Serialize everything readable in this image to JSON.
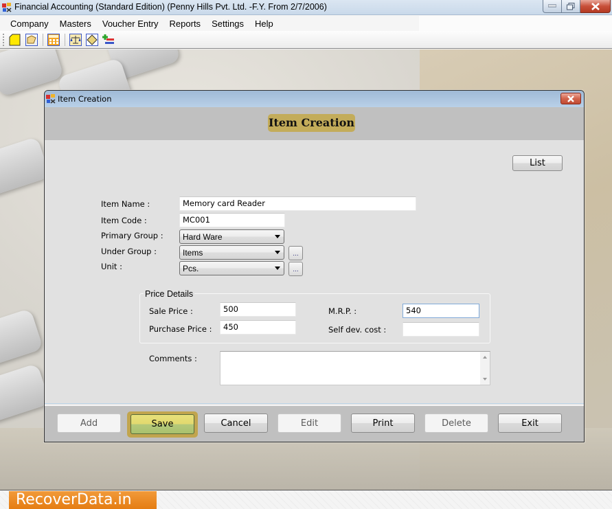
{
  "app": {
    "title": "Financial Accounting (Standard Edition) (Penny Hills Pvt. Ltd. -F.Y. From 2/7/2006)",
    "controls": [
      "minimize",
      "maximize",
      "close"
    ]
  },
  "menu": {
    "items": [
      "Company",
      "Masters",
      "Voucher Entry",
      "Reports",
      "Settings",
      "Help"
    ]
  },
  "toolbar": {
    "buttons": [
      {
        "icon": "new-document-icon"
      },
      {
        "icon": "open-folder-icon"
      },
      {
        "icon": "calculator-icon"
      },
      {
        "icon": "balance-scale-icon"
      },
      {
        "icon": "ledger-icon"
      },
      {
        "icon": "add-entry-icon"
      }
    ]
  },
  "dialog": {
    "title": "Item Creation",
    "header": "Item Creation",
    "list_label": "List",
    "fields": {
      "item_name": {
        "label": "Item Name :",
        "value": "Memory card Reader"
      },
      "item_code": {
        "label": "Item Code :",
        "value": "MC001"
      },
      "primary_group": {
        "label": "Primary Group :",
        "value": "Hard Ware"
      },
      "under_group": {
        "label": "Under Group :",
        "value": "Items"
      },
      "unit": {
        "label": "Unit :",
        "value": "Pcs."
      }
    },
    "ellipsis_label": "...",
    "price_details": {
      "title": "Price Details",
      "sale_price": {
        "label": "Sale Price :",
        "value": "500"
      },
      "purchase_price": {
        "label": "Purchase Price :",
        "value": "450"
      },
      "mrp": {
        "label": "M.R.P. :",
        "value": "540"
      },
      "self_dev_cost": {
        "label": "Self dev. cost :",
        "value": ""
      }
    },
    "comments": {
      "label": "Comments :",
      "value": ""
    },
    "buttons": {
      "add": "Add",
      "save": "Save",
      "cancel": "Cancel",
      "edit": "Edit",
      "print": "Print",
      "delete": "Delete",
      "exit": "Exit"
    }
  },
  "watermark": {
    "text": "RecoverData.in"
  }
}
